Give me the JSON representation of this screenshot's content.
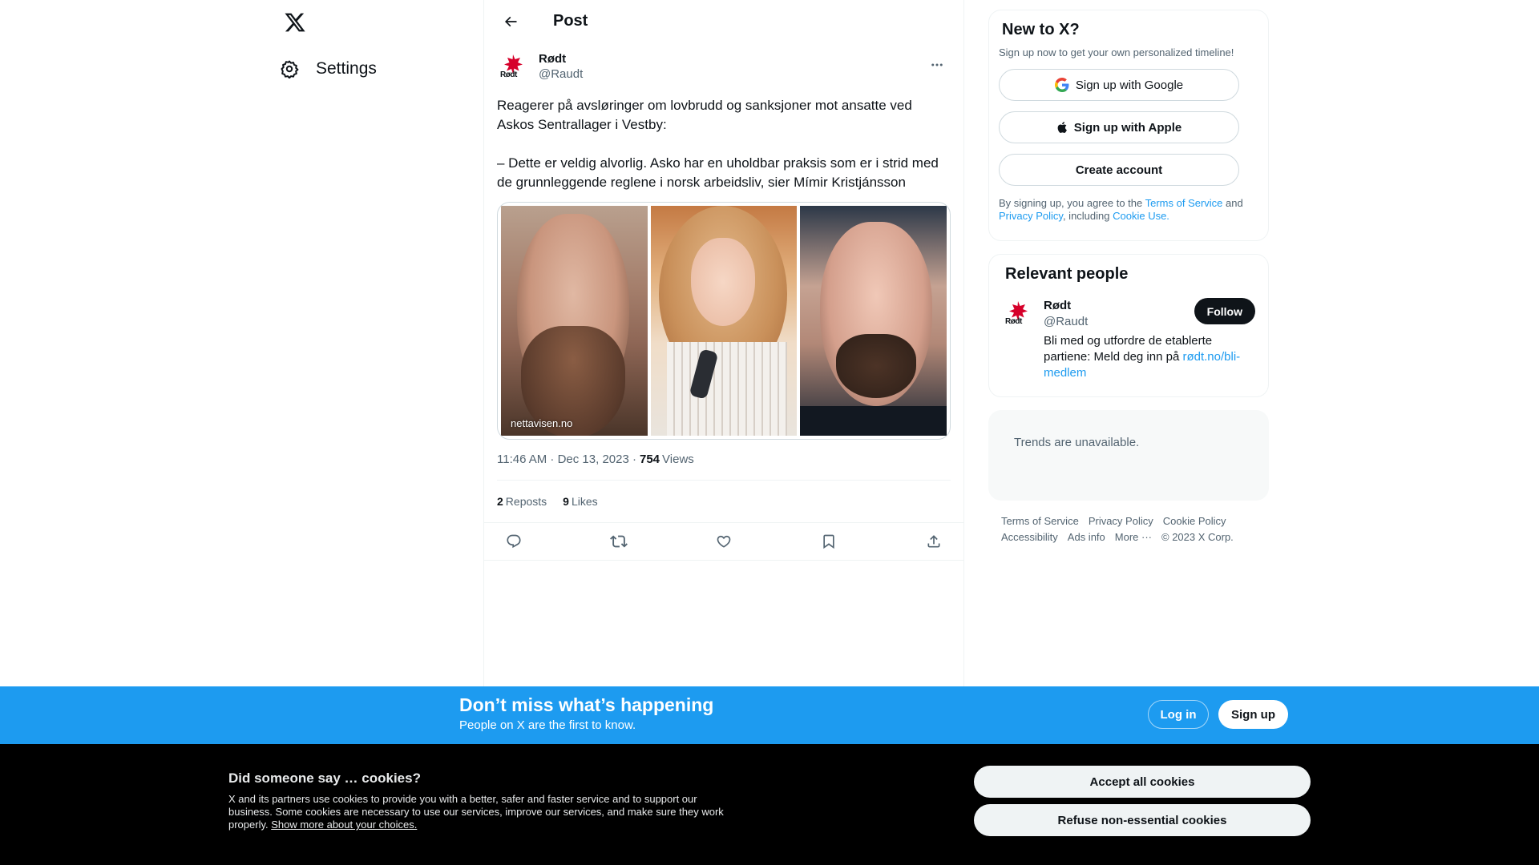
{
  "nav": {
    "settings_label": "Settings"
  },
  "header": {
    "title": "Post"
  },
  "tweet": {
    "author_name": "Rødt",
    "author_handle": "@Raudt",
    "avatar_text": "Rødt",
    "text": "Reagerer på avsløringer om lovbrudd og sanksjoner mot ansatte ved Askos Sentrallager i Vestby:\n\n– Dette er veldig alvorlig. Asko har en uholdbar praksis som er i strid med de grunnleggende reglene i norsk arbeidsliv, sier Mímir Kristjánsson",
    "media_source": "nettavisen.no",
    "timestamp": "11:46 AM · Dec 13, 2023 ·",
    "views_count": "754",
    "views_label": "Views",
    "reposts_count": "2",
    "reposts_label": "Reposts",
    "likes_count": "9",
    "likes_label": "Likes",
    "icons": [
      "reply-icon",
      "repost-icon",
      "like-icon",
      "bookmark-icon",
      "share-icon"
    ]
  },
  "signup": {
    "title": "New to X?",
    "subtitle": "Sign up now to get your own personalized timeline!",
    "google_label": "Sign up with Google",
    "apple_label": "Sign up with Apple",
    "create_label": "Create account",
    "legal_prefix": "By signing up, you agree to the ",
    "terms_link": "Terms of Service",
    "legal_and": " and ",
    "privacy_link": "Privacy Policy",
    "legal_including": ", including ",
    "cookie_link": "Cookie Use."
  },
  "relevant": {
    "title": "Relevant people",
    "name": "Rødt",
    "handle": "@Raudt",
    "bio": "Bli med og utfordre de etablerte partiene: Meld deg inn på ",
    "bio_link": "rødt.no/bli-medlem",
    "follow_label": "Follow"
  },
  "trends": {
    "message": "Trends are unavailable."
  },
  "footer": {
    "terms": "Terms of Service",
    "privacy": "Privacy Policy",
    "cookie": "Cookie Policy",
    "accessibility": "Accessibility",
    "ads": "Ads info",
    "more": "More ···",
    "copyright": "© 2023 X Corp."
  },
  "bottom_bar": {
    "title": "Don’t miss what’s happening",
    "subtitle": "People on X are the first to know.",
    "login_label": "Log in",
    "signup_label": "Sign up",
    "color": "#1d9bf0"
  },
  "cookies": {
    "title": "Did someone say … cookies?",
    "text": "X and its partners use cookies to provide you with a better, safer and faster service and to support our business. Some cookies are necessary to use our services, improve our services, and make sure they work properly. ",
    "link": "Show more about your choices.",
    "accept_label": "Accept all cookies",
    "refuse_label": "Refuse non-essential cookies"
  },
  "colors": {
    "accent": "#1d9bf0",
    "text": "#0f1419",
    "muted": "#536471",
    "brand_red": "#d6002a"
  }
}
